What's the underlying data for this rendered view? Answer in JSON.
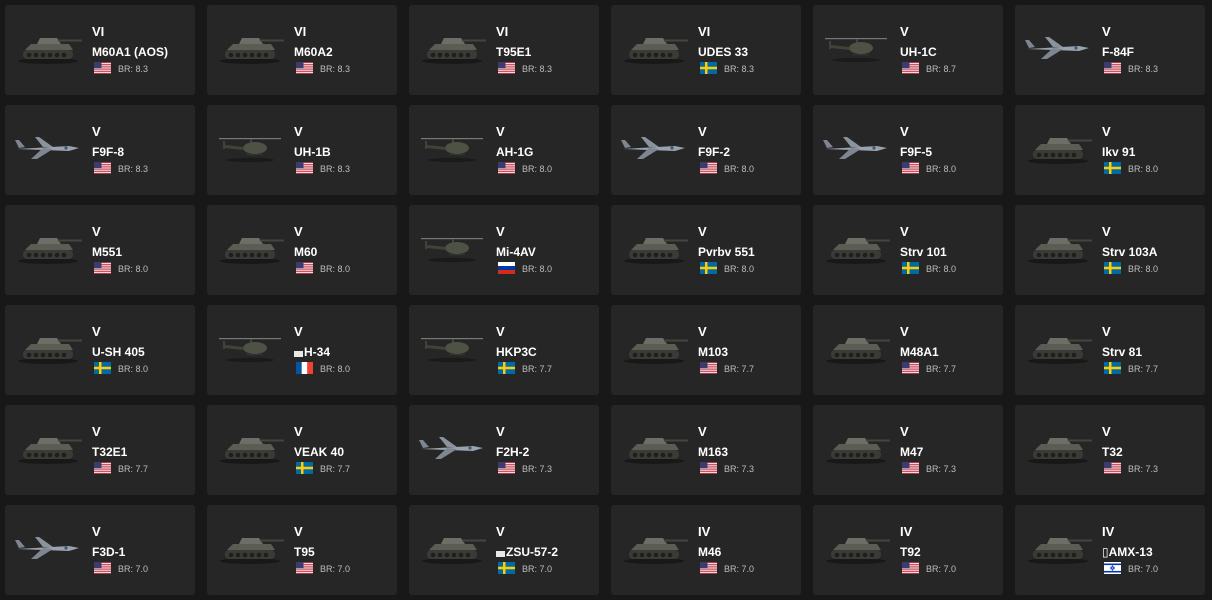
{
  "vehicles": [
    {
      "rank": "VI",
      "name": "M60A1 (AOS)",
      "br": "BR: 8.3",
      "country": "usa",
      "type": "tank",
      "prefix": false
    },
    {
      "rank": "VI",
      "name": "M60A2",
      "br": "BR: 8.3",
      "country": "usa",
      "type": "tank",
      "prefix": false
    },
    {
      "rank": "VI",
      "name": "T95E1",
      "br": "BR: 8.3",
      "country": "usa",
      "type": "tank",
      "prefix": false
    },
    {
      "rank": "VI",
      "name": "UDES 33",
      "br": "BR: 8.3",
      "country": "sweden",
      "type": "tank",
      "prefix": false
    },
    {
      "rank": "V",
      "name": "UH-1C",
      "br": "BR: 8.7",
      "country": "usa",
      "type": "heli",
      "prefix": false
    },
    {
      "rank": "V",
      "name": "F-84F",
      "br": "BR: 8.3",
      "country": "usa",
      "type": "jet",
      "prefix": false
    },
    {
      "rank": "V",
      "name": "F9F-8",
      "br": "BR: 8.3",
      "country": "usa",
      "type": "jet",
      "prefix": false
    },
    {
      "rank": "V",
      "name": "UH-1B",
      "br": "BR: 8.3",
      "country": "usa",
      "type": "heli",
      "prefix": false
    },
    {
      "rank": "V",
      "name": "AH-1G",
      "br": "BR: 8.0",
      "country": "usa",
      "type": "heli",
      "prefix": false
    },
    {
      "rank": "V",
      "name": "F9F-2",
      "br": "BR: 8.0",
      "country": "usa",
      "type": "jet",
      "prefix": false
    },
    {
      "rank": "V",
      "name": "F9F-5",
      "br": "BR: 8.0",
      "country": "usa",
      "type": "jet",
      "prefix": false
    },
    {
      "rank": "V",
      "name": "Ikv 91",
      "br": "BR: 8.0",
      "country": "sweden",
      "type": "tank",
      "prefix": false
    },
    {
      "rank": "V",
      "name": "M551",
      "br": "BR: 8.0",
      "country": "usa",
      "type": "tank",
      "prefix": false
    },
    {
      "rank": "V",
      "name": "M60",
      "br": "BR: 8.0",
      "country": "usa",
      "type": "tank",
      "prefix": false
    },
    {
      "rank": "V",
      "name": "Mi-4AV",
      "br": "BR: 8.0",
      "country": "russia",
      "type": "heli",
      "prefix": false
    },
    {
      "rank": "V",
      "name": "Pvrbv 551",
      "br": "BR: 8.0",
      "country": "sweden",
      "type": "tank",
      "prefix": false
    },
    {
      "rank": "V",
      "name": "Strv 101",
      "br": "BR: 8.0",
      "country": "sweden",
      "type": "tank",
      "prefix": false
    },
    {
      "rank": "V",
      "name": "Strv 103A",
      "br": "BR: 8.0",
      "country": "sweden",
      "type": "tank",
      "prefix": false
    },
    {
      "rank": "V",
      "name": "U-SH 405",
      "br": "BR: 8.0",
      "country": "sweden",
      "type": "tank",
      "prefix": false
    },
    {
      "rank": "V",
      "name": "H-34",
      "br": "BR: 8.0",
      "country": "france",
      "type": "heli",
      "prefix": true
    },
    {
      "rank": "V",
      "name": "HKP3C",
      "br": "BR: 7.7",
      "country": "sweden",
      "type": "heli",
      "prefix": false
    },
    {
      "rank": "V",
      "name": "M103",
      "br": "BR: 7.7",
      "country": "usa",
      "type": "tank",
      "prefix": false
    },
    {
      "rank": "V",
      "name": "M48A1",
      "br": "BR: 7.7",
      "country": "usa",
      "type": "tank",
      "prefix": false
    },
    {
      "rank": "V",
      "name": "Strv 81",
      "br": "BR: 7.7",
      "country": "sweden",
      "type": "tank",
      "prefix": false
    },
    {
      "rank": "V",
      "name": "T32E1",
      "br": "BR: 7.7",
      "country": "usa",
      "type": "tank",
      "prefix": false
    },
    {
      "rank": "V",
      "name": "VEAK 40",
      "br": "BR: 7.7",
      "country": "sweden",
      "type": "tank",
      "prefix": false
    },
    {
      "rank": "V",
      "name": "F2H-2",
      "br": "BR: 7.3",
      "country": "usa",
      "type": "jet",
      "prefix": false
    },
    {
      "rank": "V",
      "name": "M163",
      "br": "BR: 7.3",
      "country": "usa",
      "type": "tank",
      "prefix": false
    },
    {
      "rank": "V",
      "name": "M47",
      "br": "BR: 7.3",
      "country": "usa",
      "type": "tank",
      "prefix": false
    },
    {
      "rank": "V",
      "name": "T32",
      "br": "BR: 7.3",
      "country": "usa",
      "type": "tank",
      "prefix": false
    },
    {
      "rank": "V",
      "name": "F3D-1",
      "br": "BR: 7.0",
      "country": "usa",
      "type": "jet",
      "prefix": false
    },
    {
      "rank": "V",
      "name": "T95",
      "br": "BR: 7.0",
      "country": "usa",
      "type": "tank",
      "prefix": false
    },
    {
      "rank": "V",
      "name": "ZSU-57-2",
      "br": "BR: 7.0",
      "country": "sweden",
      "type": "tank",
      "prefix": true
    },
    {
      "rank": "IV",
      "name": "M46",
      "br": "BR: 7.0",
      "country": "usa",
      "type": "tank",
      "prefix": false
    },
    {
      "rank": "IV",
      "name": "T92",
      "br": "BR: 7.0",
      "country": "usa",
      "type": "tank",
      "prefix": false
    },
    {
      "rank": "IV",
      "name": "▯AMX-13",
      "br": "BR: 7.0",
      "country": "israel",
      "type": "tank",
      "prefix": false
    }
  ],
  "colors": {
    "page_bg": "#181818",
    "card_bg": "#262626",
    "br_text": "#bdbdbd"
  }
}
